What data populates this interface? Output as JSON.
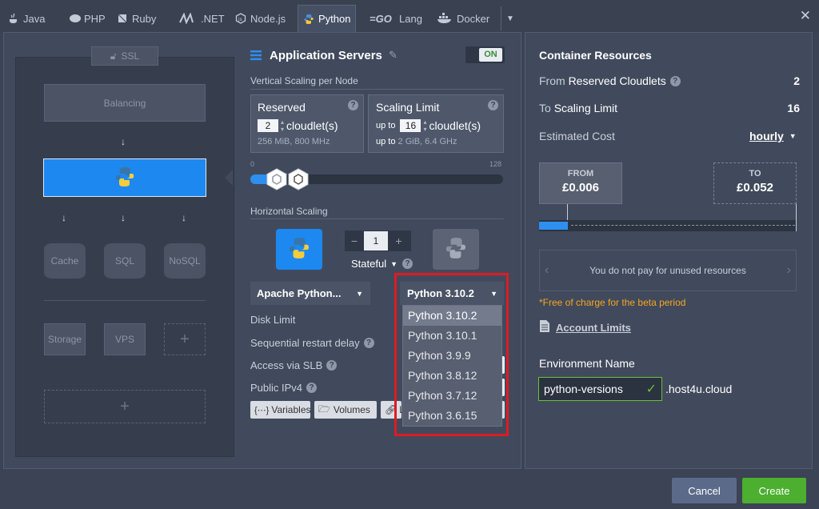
{
  "tabs": [
    {
      "label": "Java",
      "icon": "java-icon"
    },
    {
      "label": "PHP",
      "icon": "php-icon"
    },
    {
      "label": "Ruby",
      "icon": "ruby-icon"
    },
    {
      "label": ".NET",
      "icon": "dotnet-icon"
    },
    {
      "label": "Node.js",
      "icon": "nodejs-icon"
    },
    {
      "label": "Python",
      "icon": "python-icon",
      "active": true
    },
    {
      "label": "Lang",
      "icon": "go-icon"
    },
    {
      "label": "Docker",
      "icon": "docker-icon"
    }
  ],
  "topology": {
    "ssl": "SSL",
    "balancing": "Balancing",
    "cache": "Cache",
    "sql": "SQL",
    "nosql": "NoSQL",
    "storage": "Storage",
    "vps": "VPS"
  },
  "app_servers": {
    "title": "Application Servers",
    "toggle": "ON",
    "vertical_label": "Vertical Scaling per Node",
    "reserved": {
      "title": "Reserved",
      "value": "2",
      "unit": "cloudlet(s)",
      "detail": "256 MiB, 800 MHz"
    },
    "scaling_limit": {
      "title": "Scaling Limit",
      "prefix": "up to",
      "value": "16",
      "unit": "cloudlet(s)",
      "detail_prefix": "up to",
      "detail": "2 GiB, 6.4 GHz"
    },
    "slider": {
      "min": "0",
      "max": "128",
      "reserved": 2,
      "limit": 16
    },
    "horizontal_label": "Horizontal Scaling",
    "nodes": "1",
    "stateful": "Stateful",
    "stack": "Apache Python...",
    "version": "Python 3.10.2",
    "disk_limit": "Disk Limit",
    "restart_delay": "Sequential restart delay",
    "access_slb": "Access via SLB",
    "public_ipv4": "Public IPv4",
    "chips": [
      "Variables",
      "Volumes",
      "L"
    ]
  },
  "version_options": [
    "Python 3.10.2",
    "Python 3.10.1",
    "Python 3.9.9",
    "Python 3.8.12",
    "Python 3.7.12",
    "Python 3.6.15"
  ],
  "resources": {
    "title": "Container Resources",
    "from_label": "From",
    "from_bold": "Reserved Cloudlets",
    "from_value": "2",
    "to_label": "To",
    "to_bold": "Scaling Limit",
    "to_value": "16",
    "cost_label": "Estimated Cost",
    "period": "hourly",
    "from_price_label": "FROM",
    "from_price": "£0.006",
    "to_price_label": "TO",
    "to_price": "£0.052",
    "unused_note": "You do not pay for unused resources",
    "beta_note": "*Free of charge for the beta period",
    "account_limits": "Account Limits",
    "env_label": "Environment Name",
    "env_value": "python-versions",
    "domain": ".host4u.cloud"
  },
  "footer": {
    "cancel": "Cancel",
    "create": "Create"
  }
}
